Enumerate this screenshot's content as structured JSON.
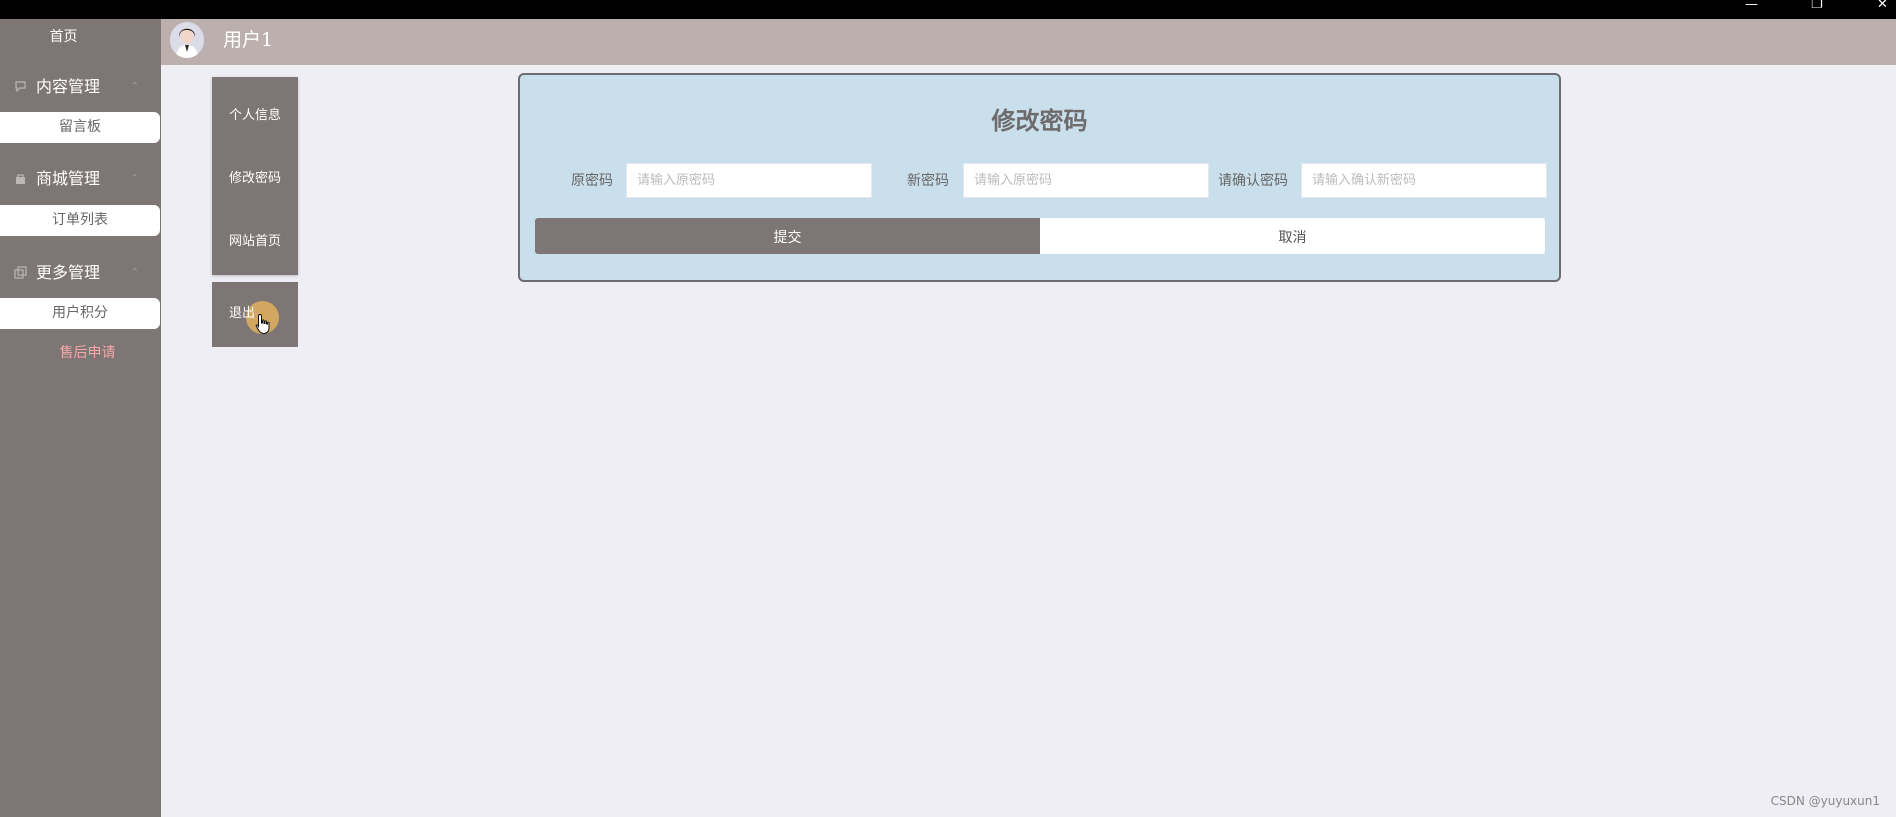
{
  "sidebar": {
    "home": "首页",
    "groups": [
      {
        "title": "内容管理",
        "icon": "chat-bubble-icon",
        "items": [
          "留言板"
        ]
      },
      {
        "title": "商城管理",
        "icon": "shop-icon",
        "items": [
          "订单列表"
        ]
      },
      {
        "title": "更多管理",
        "icon": "copy-icon",
        "items": [
          "用户积分"
        ]
      }
    ],
    "extra_item": "售后申请"
  },
  "header": {
    "username": "用户1"
  },
  "dropdown": {
    "items": [
      "个人信息",
      "修改密码",
      "网站首页"
    ],
    "logout": "退出"
  },
  "form": {
    "title": "修改密码",
    "old_label": "原密码",
    "old_placeholder": "请输入原密码",
    "new_label": "新密码",
    "new_placeholder": "请输入原密码",
    "confirm_label": "请确认密码",
    "confirm_placeholder": "请输入确认新密码",
    "submit": "提交",
    "cancel": "取消"
  },
  "window_controls": {
    "minimize": "—",
    "restore": "❐",
    "close": "✕"
  },
  "watermark": "CSDN @yuyuxun1",
  "colors": {
    "sidebar": "#7e7575",
    "header": "#bcb0ae",
    "card": "#c9dfeb",
    "page": "#efeef4",
    "highlight_text": "#f6a8a8"
  }
}
